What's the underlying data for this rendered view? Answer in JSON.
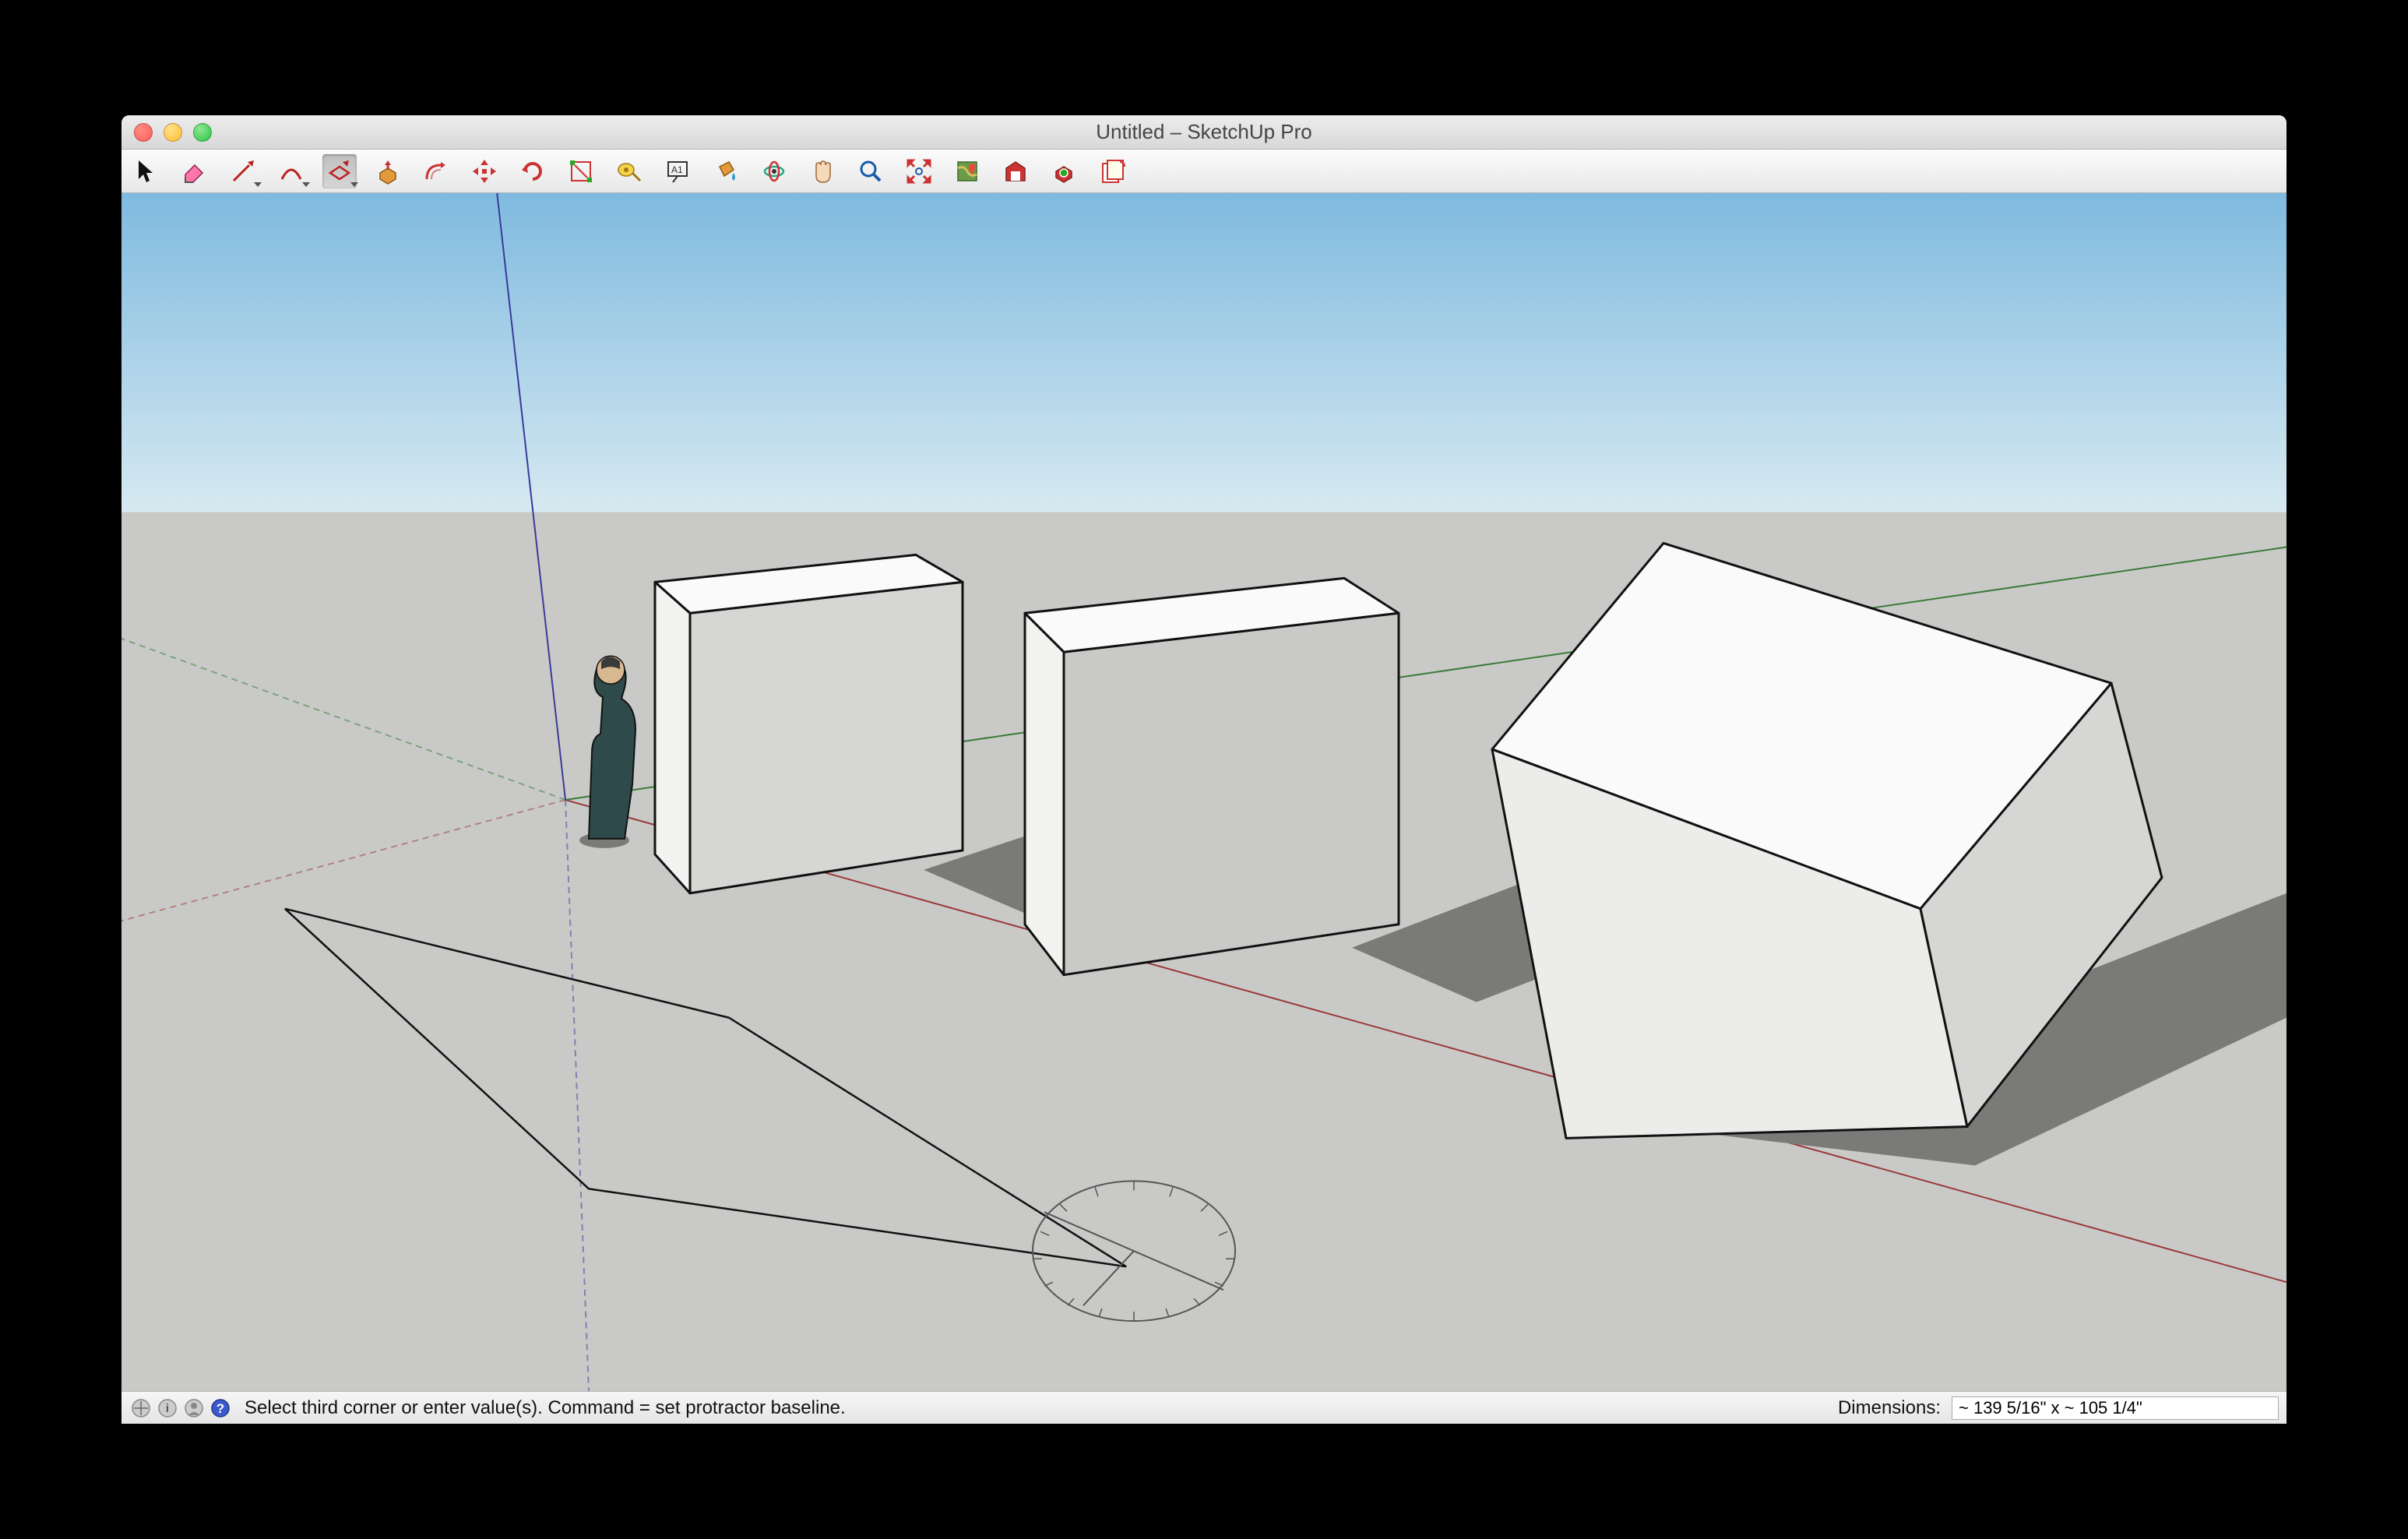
{
  "window": {
    "title": "Untitled – SketchUp Pro"
  },
  "toolbar": {
    "tools": [
      {
        "name": "select-tool-icon"
      },
      {
        "name": "eraser-tool-icon"
      },
      {
        "name": "line-tool-icon",
        "dropdown": true
      },
      {
        "name": "arc-tool-icon",
        "dropdown": true
      },
      {
        "name": "rectangle-tool-icon",
        "dropdown": true,
        "active": true
      },
      {
        "name": "pushpull-tool-icon"
      },
      {
        "name": "offset-tool-icon"
      },
      {
        "name": "move-tool-icon"
      },
      {
        "name": "rotate-tool-icon"
      },
      {
        "name": "scale-tool-icon"
      },
      {
        "name": "tape-measure-tool-icon"
      },
      {
        "name": "text-tool-icon"
      },
      {
        "name": "paint-bucket-tool-icon"
      },
      {
        "name": "orbit-tool-icon"
      },
      {
        "name": "pan-tool-icon"
      },
      {
        "name": "zoom-tool-icon"
      },
      {
        "name": "zoom-extents-tool-icon"
      },
      {
        "name": "add-location-tool-icon"
      },
      {
        "name": "3dwarehouse-tool-icon"
      },
      {
        "name": "extension-warehouse-tool-icon"
      },
      {
        "name": "layout-tool-icon"
      }
    ]
  },
  "status": {
    "hint": "Select third corner or enter value(s). Command = set protractor baseline.",
    "dim_label": "Dimensions:",
    "dim_value": "~ 139 5/16\" x ~ 105 1/4\""
  },
  "scene": {
    "axes": [
      "red",
      "green",
      "blue"
    ],
    "ground_color": "#c9cac7",
    "sky_gradient_top": "#7fbadf",
    "sky_gradient_bottom": "#d6e9f1",
    "objects": [
      "scale-figure",
      "cube-1",
      "cube-2",
      "tilted-cube",
      "rotated-rectangle-outline",
      "protractor"
    ]
  }
}
